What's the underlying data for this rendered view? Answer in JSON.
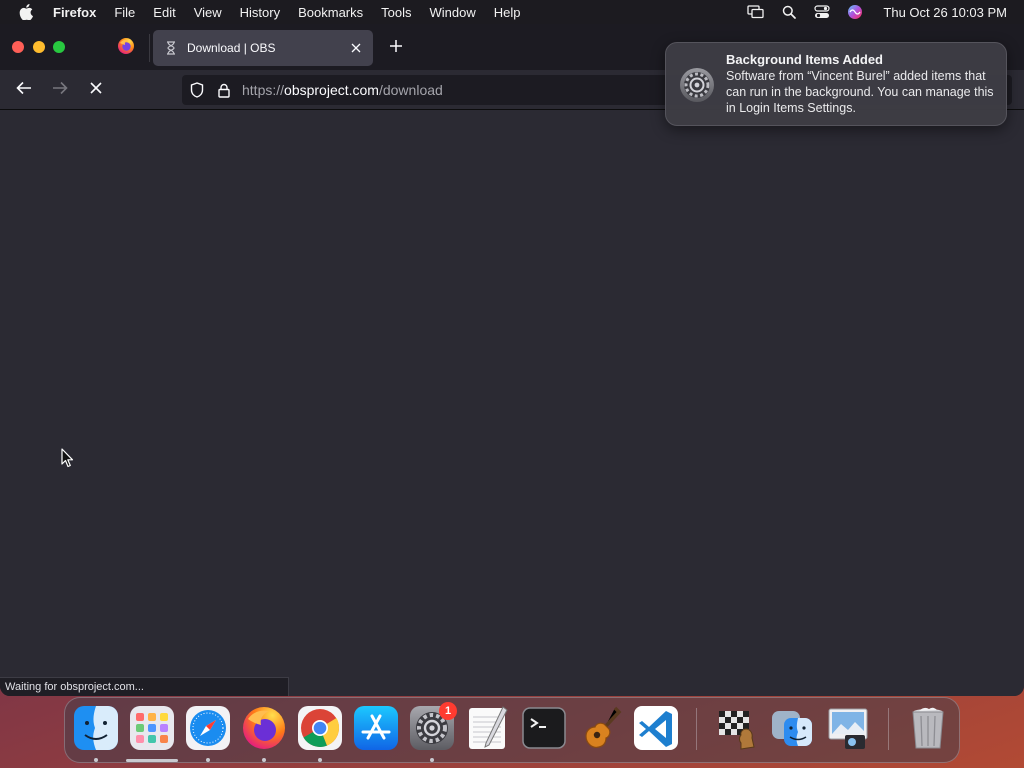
{
  "menubar": {
    "app_name": "Firefox",
    "items": [
      "File",
      "Edit",
      "View",
      "History",
      "Bookmarks",
      "Tools",
      "Window",
      "Help"
    ],
    "clock": "Thu Oct 26  10:03 PM"
  },
  "browser": {
    "tab": {
      "title": "Download | OBS"
    },
    "url": {
      "scheme": "https://",
      "host": "obsproject.com",
      "path": "/download"
    },
    "status_text": "Waiting for obsproject.com..."
  },
  "notification": {
    "title": "Background Items Added",
    "body": "Software from “Vincent Burel” added items that can run in the background. You can manage this in Login Items Settings."
  },
  "dock": {
    "apps": [
      "Finder",
      "Launchpad",
      "Safari",
      "Firefox",
      "Chrome",
      "App Store",
      "System Settings",
      "TextEdit",
      "Terminal",
      "GarageBand",
      "Visual Studio Code",
      "Chess",
      "Migration Assistant",
      "Preview",
      "Trash"
    ],
    "system_settings_badge": "1"
  },
  "colors": {
    "tab_bg": "#42414d",
    "toolbar_bg": "#2b2a33",
    "badge": "#ff3b30"
  }
}
